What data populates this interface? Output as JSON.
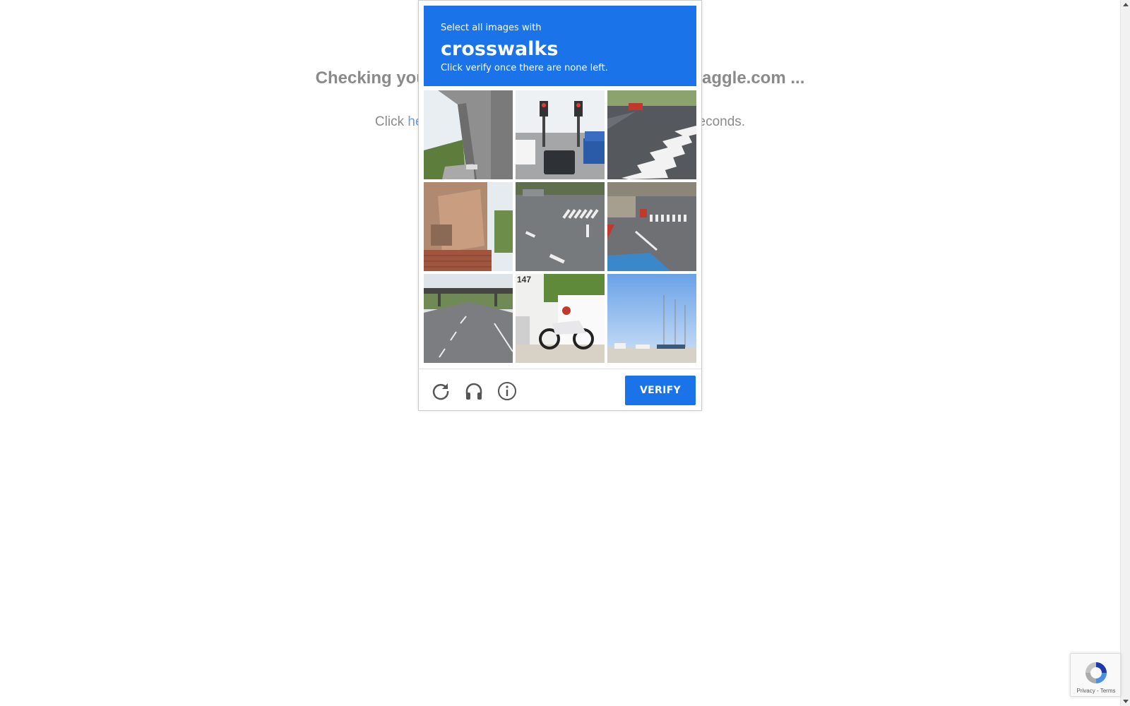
{
  "page": {
    "heading_start": "Checking you",
    "heading_end": "aggle.com ...",
    "sub_start": "Click ",
    "sub_link": "he",
    "sub_end": "econds."
  },
  "captcha": {
    "instruction": "Select all images with",
    "target": "crosswalks",
    "hint": "Click verify once there are none left.",
    "tiles": [
      {
        "label": "highway overpass"
      },
      {
        "label": "traffic lights and cars"
      },
      {
        "label": "road with crosswalk"
      },
      {
        "label": "brick building with stairs"
      },
      {
        "label": "intersection with crosswalk"
      },
      {
        "label": "road with crosswalk under overpass"
      },
      {
        "label": "highway with pedestrian bridge"
      },
      {
        "label": "motorcycle parked by building"
      },
      {
        "label": "harbor with sailboats"
      }
    ],
    "tile_sign_text": "147",
    "verify_label": "VERIFY",
    "icons": [
      "reload-icon",
      "headphones-icon",
      "info-icon"
    ],
    "accent_color": "#1a73e8"
  },
  "badge": {
    "links": "Privacy - Terms"
  }
}
